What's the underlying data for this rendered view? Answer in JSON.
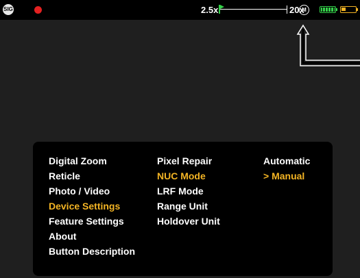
{
  "status_bar": {
    "logo_text": "SIG",
    "zoom_min": "2.5x",
    "zoom_max": "20x",
    "mode_icon_text": "M",
    "battery_icon": "battery-full-icon",
    "external_battery_icon": "battery-low-icon",
    "colors": {
      "record": "#e42121",
      "battery": "#35d24a",
      "external_battery": "#f3b424"
    }
  },
  "menu": {
    "main": [
      {
        "label": "Digital Zoom",
        "active": false
      },
      {
        "label": "Reticle",
        "active": false
      },
      {
        "label": "Photo / Video",
        "active": false
      },
      {
        "label": "Device Settings",
        "active": true
      },
      {
        "label": "Feature Settings",
        "active": false
      },
      {
        "label": "About",
        "active": false
      },
      {
        "label": "Button Description",
        "active": false
      }
    ],
    "sub": [
      {
        "label": "Pixel Repair",
        "active": false
      },
      {
        "label": "NUC Mode",
        "active": true
      },
      {
        "label": "LRF Mode",
        "active": false
      },
      {
        "label": "Range Unit",
        "active": false
      },
      {
        "label": "Holdover Unit",
        "active": false
      }
    ],
    "options": [
      {
        "label": "Automatic",
        "active": false
      },
      {
        "label": "> Manual",
        "active": true
      }
    ],
    "colors": {
      "text": "#ffffff",
      "highlight": "#f3b424",
      "panel": "#000000"
    }
  }
}
